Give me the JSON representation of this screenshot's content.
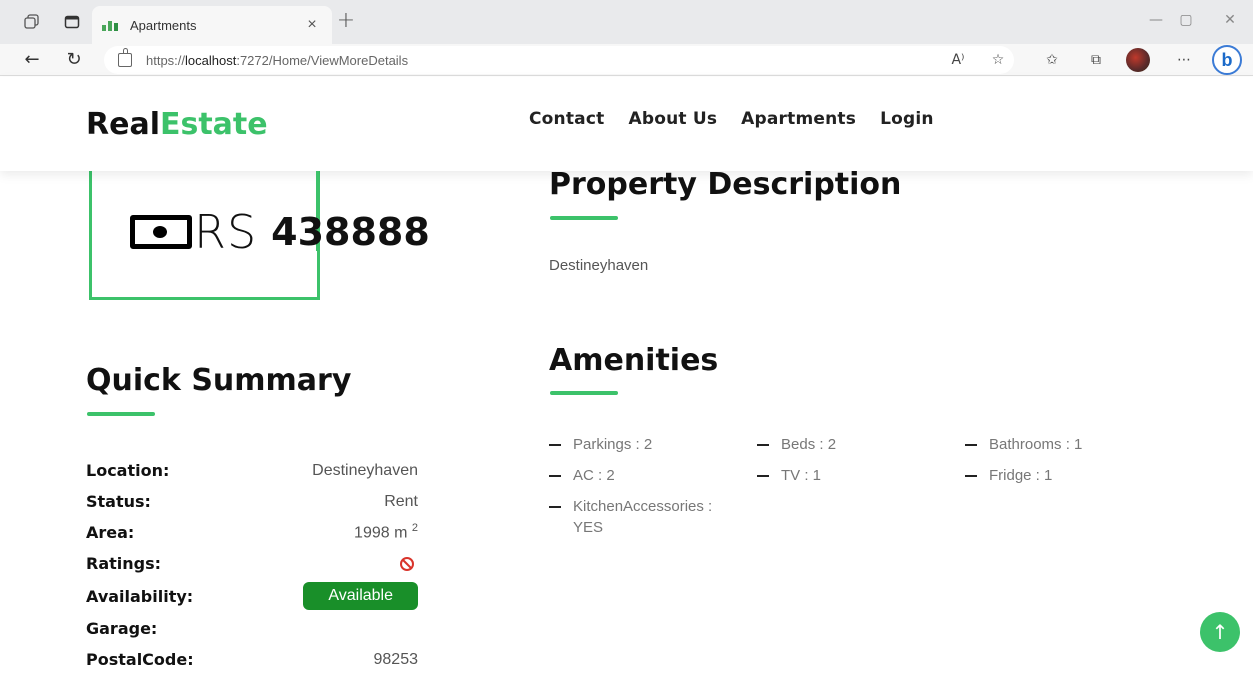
{
  "browser": {
    "tab_title": "Apartments",
    "tab_close": "×",
    "new_tab": "+",
    "url_prefix": "https://",
    "url_host": "localhost",
    "url_rest": ":7272/Home/ViewMoreDetails",
    "read_aloud": "A⁾",
    "more": "⋯",
    "bing": "b"
  },
  "site": {
    "logo_main": "Real",
    "logo_accent": "Estate",
    "nav": [
      "Contact",
      "About Us",
      "Apartments",
      "Login"
    ]
  },
  "price": {
    "currency": "RS",
    "value": "438888"
  },
  "description": {
    "title": "Property Description",
    "text": "Destineyhaven"
  },
  "summary": {
    "title": "Quick Summary",
    "rows": [
      {
        "label": "Location:",
        "value": "Destineyhaven"
      },
      {
        "label": "Status:",
        "value": "Rent"
      },
      {
        "label": "Area:",
        "value": "1998 m",
        "sup": "2"
      },
      {
        "label": "Ratings:",
        "value": ""
      },
      {
        "label": "Availability:",
        "value": "Available"
      },
      {
        "label": "Garage:",
        "value": ""
      },
      {
        "label": "PostalCode:",
        "value": "98253"
      }
    ]
  },
  "amenities": {
    "title": "Amenities",
    "items": [
      "Parkings : 2",
      "Beds : 2",
      "Bathrooms : 1",
      "AC : 2",
      "TV : 1",
      "Fridge : 1",
      "KitchenAccessories : YES"
    ]
  },
  "colors": {
    "accent": "#3cc26a",
    "available_badge": "#198f29",
    "no_rating": "#d9342b"
  },
  "icons": [
    "money-icon",
    "no-entry-icon",
    "arrow-up-icon"
  ]
}
